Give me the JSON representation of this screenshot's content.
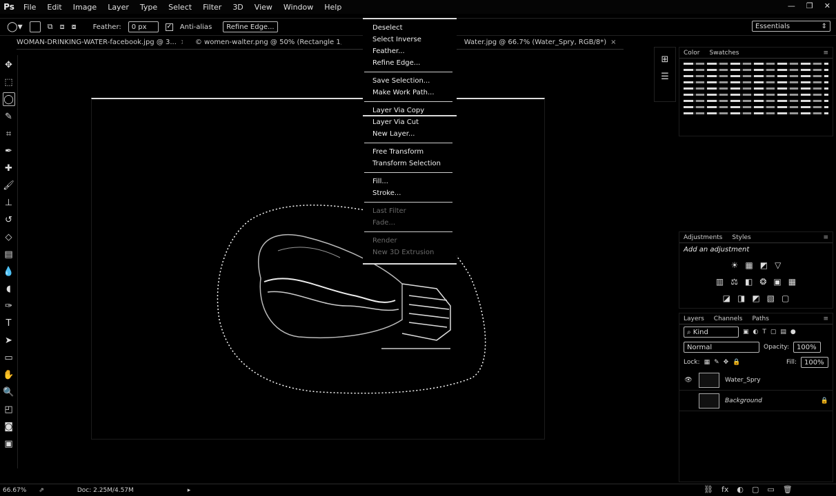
{
  "app": {
    "logo": "Ps"
  },
  "menu": [
    "File",
    "Edit",
    "Image",
    "Layer",
    "Type",
    "Select",
    "Filter",
    "3D",
    "View",
    "Window",
    "Help"
  ],
  "window_controls": [
    "—",
    "❐",
    "✕"
  ],
  "options": {
    "feather_label": "Feather:",
    "feather_value": "0 px",
    "antialias_label": "Anti-alias",
    "antialias_checked": "✓",
    "refine_label": "Refine Edge...",
    "workspace": "Essentials"
  },
  "tabs": [
    "WOMAN-DRINKING-WATER-facebook.jpg @ 3...",
    "© women-walter.png @ 50% (Rectangle 1, R...",
    "Water.jpg @ 66.7% (Water_Spry, RGB/8*)"
  ],
  "context_menu": [
    {
      "label": "Deselect",
      "state": "normal"
    },
    {
      "label": "Select Inverse",
      "state": "normal"
    },
    {
      "label": "Feather...",
      "state": "normal"
    },
    {
      "label": "Refine Edge...",
      "state": "normal"
    },
    {
      "sep": true
    },
    {
      "label": "Save Selection...",
      "state": "normal"
    },
    {
      "label": "Make Work Path...",
      "state": "normal"
    },
    {
      "sep": true
    },
    {
      "label": "Layer Via Copy",
      "state": "highlight"
    },
    {
      "label": "Layer Via Cut",
      "state": "normal"
    },
    {
      "label": "New Layer...",
      "state": "normal"
    },
    {
      "sep": true
    },
    {
      "label": "Free Transform",
      "state": "normal"
    },
    {
      "label": "Transform Selection",
      "state": "normal"
    },
    {
      "sep": true
    },
    {
      "label": "Fill...",
      "state": "normal"
    },
    {
      "label": "Stroke...",
      "state": "normal"
    },
    {
      "sep": true
    },
    {
      "label": "Last Filter",
      "state": "dim"
    },
    {
      "label": "Fade...",
      "state": "dim"
    },
    {
      "sep": true
    },
    {
      "label": "Render",
      "state": "dim"
    },
    {
      "label": "New 3D Extrusion",
      "state": "dim"
    }
  ],
  "panels": {
    "color_tabs": [
      "Color",
      "Swatches"
    ],
    "adjust_tabs": [
      "Adjustments",
      "Styles"
    ],
    "adjust_title": "Add an adjustment",
    "adjust_icons_row1": [
      "☀",
      "▦",
      "◩",
      "▽"
    ],
    "adjust_icons_row2": [
      "▥",
      "⚖",
      "◧",
      "❂",
      "▣",
      "▦"
    ],
    "adjust_icons_row3": [
      "◪",
      "◨",
      "◩",
      "▧",
      "▢"
    ],
    "layers_tabs": [
      "Layers",
      "Channels",
      "Paths"
    ],
    "kind_label": "Kind",
    "blend_mode": "Normal",
    "opacity_label": "Opacity:",
    "opacity_value": "100%",
    "lock_label": "Lock:",
    "fill_label": "Fill:",
    "fill_value": "100%",
    "layers": [
      {
        "name": "Water_Spry",
        "visible": "👁"
      },
      {
        "name": "Background",
        "visible": "",
        "lock": "🔒"
      }
    ]
  },
  "status": {
    "zoom": "66.67%",
    "doc": "Doc: 2.25M/4.57M"
  },
  "layer_footer": [
    "⛓",
    "fx",
    "◐",
    "▢",
    "▭",
    "🗑"
  ]
}
